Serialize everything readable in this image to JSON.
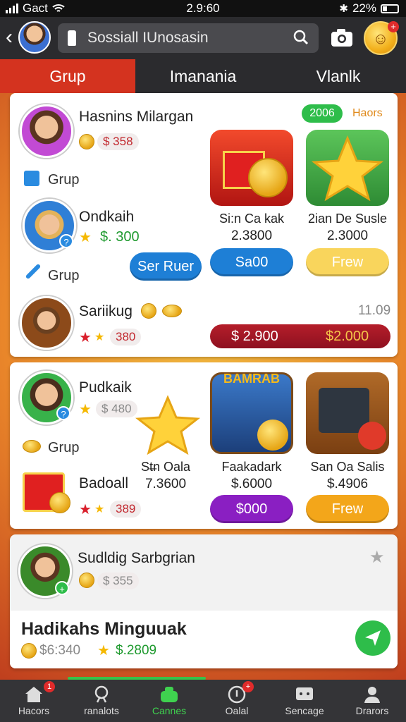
{
  "status": {
    "carrier": "Gact",
    "time": "2.9:60",
    "battery": "22%"
  },
  "header": {
    "search_text": "Sossiall IUnosasin",
    "coin_face": "☺",
    "coin_plus": "+"
  },
  "tabs": [
    {
      "label": "Grup"
    },
    {
      "label": "Imanania"
    },
    {
      "label": "Vlanlk"
    }
  ],
  "card1": {
    "tag_green": "2006",
    "tag_orange": "Haors",
    "user1": {
      "name": "Hasnins Milargan",
      "amount": "$  358"
    },
    "section1": "Grup",
    "user2": {
      "name": "Ondkaih",
      "amount": "$. 300",
      "button": "Ser Ruer"
    },
    "section2": "Grup",
    "user3": {
      "name": "Sariikug",
      "amount": "380",
      "side_value": "11.09"
    },
    "tile1": {
      "caption": "Si:n Ca kak",
      "value": "2.3800",
      "button": "Sa00"
    },
    "tile2": {
      "caption": "2ian De Susle",
      "value": "2.3000",
      "button": "Frew"
    },
    "bar_left": "$ 2.900",
    "bar_right": "$2.000"
  },
  "card2": {
    "user1": {
      "name": "Pudkaik",
      "amount": "$  480"
    },
    "section": "Grup",
    "user2": {
      "name": "Badoall",
      "amount": "389"
    },
    "tile1": {
      "caption": "St̶n Oala",
      "value": "7.3600"
    },
    "tile2": {
      "caption": "Faakadark",
      "value": "$.6000",
      "button": "$000",
      "art_text": "BAMRAB"
    },
    "tile3": {
      "caption": "San Oa Salis",
      "value": "$.4906",
      "button": "Frew"
    }
  },
  "card3": {
    "user1": {
      "name": "Sudldig Sarbgrian",
      "amount": "$  355"
    },
    "title": "Hadikahs Minguuak",
    "amount1": "$6:340",
    "amount2": "$.2809"
  },
  "nav": [
    {
      "label": "Hacors",
      "badge": "1"
    },
    {
      "label": "ranalots",
      "badge": ""
    },
    {
      "label": "Cannes",
      "badge": ""
    },
    {
      "label": "Oalal",
      "badge": "+"
    },
    {
      "label": "Sencage",
      "badge": ""
    },
    {
      "label": "Drarors",
      "badge": ""
    }
  ],
  "colors": {
    "accent_red": "#d4331f",
    "header_dark": "#2b2b2e",
    "green": "#2ebd4a",
    "blue_button": "#1e7fd6",
    "purple_button": "#8a1fc2",
    "yellow_button": "#f3a61a"
  }
}
